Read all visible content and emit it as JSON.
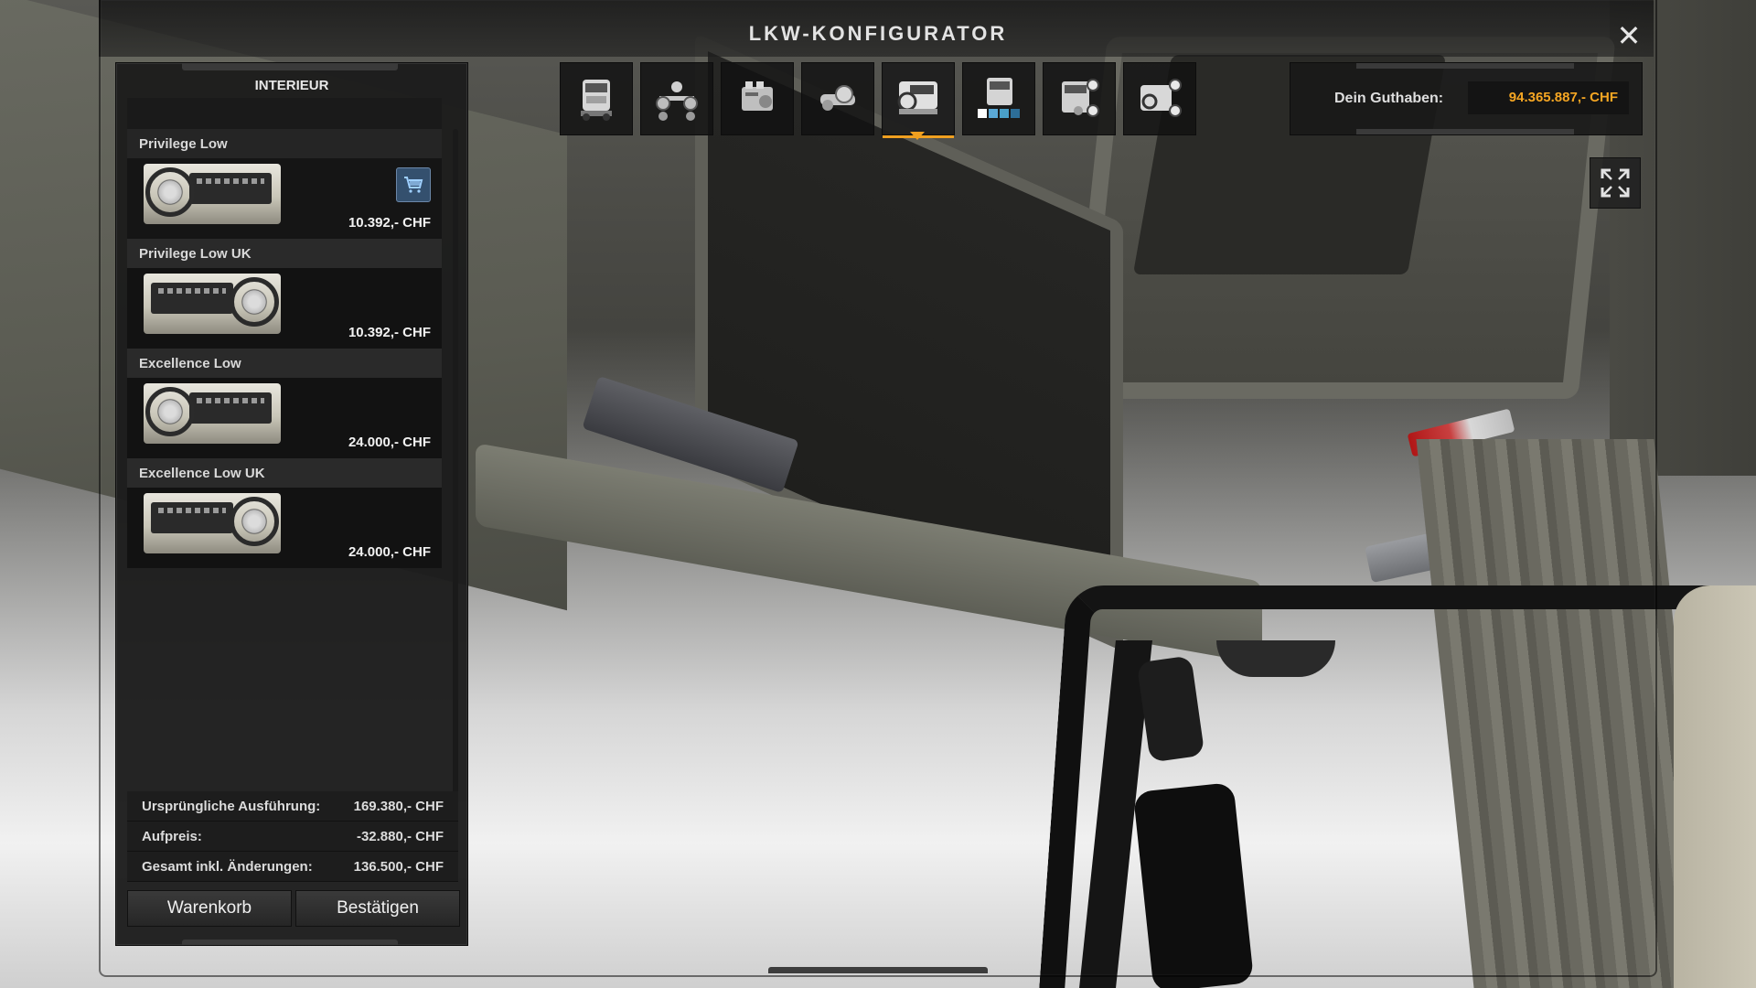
{
  "window": {
    "title": "LKW-KONFIGURATOR",
    "close_icon": "close-icon"
  },
  "panel": {
    "title": "INTERIEUR",
    "items": [
      {
        "name": "Privilege Low",
        "price": "10.392,- CHF",
        "selected": true,
        "in_cart": true
      },
      {
        "name": "Privilege Low UK",
        "price": "10.392,- CHF",
        "selected": false,
        "in_cart": false
      },
      {
        "name": "Excellence Low",
        "price": "24.000,- CHF",
        "selected": false,
        "in_cart": false
      },
      {
        "name": "Excellence Low UK",
        "price": "24.000,- CHF",
        "selected": false,
        "in_cart": false
      }
    ],
    "summary": {
      "original_label": "Ursprüngliche Ausführung:",
      "original_value": "169.380,- CHF",
      "surcharge_label": "Aufpreis:",
      "surcharge_value": "-32.880,- CHF",
      "total_label": "Gesamt inkl. Änderungen:",
      "total_value": "136.500,- CHF"
    },
    "buttons": {
      "cart": "Warenkorb",
      "confirm": "Bestätigen"
    }
  },
  "toolbar": {
    "categories": [
      {
        "icon": "cabin-icon"
      },
      {
        "icon": "chassis-icon"
      },
      {
        "icon": "engine-icon"
      },
      {
        "icon": "transmission-icon"
      },
      {
        "icon": "interior-icon",
        "active": true
      },
      {
        "icon": "paint-icon"
      },
      {
        "icon": "exterior-accessories-icon"
      },
      {
        "icon": "interior-accessories-icon"
      }
    ]
  },
  "balance": {
    "label": "Dein Guthaben:",
    "value": "94.365.887,- CHF"
  },
  "colors": {
    "accent": "#f0a020",
    "balance_value": "#f5a623",
    "cart_badge": "#34506e"
  }
}
